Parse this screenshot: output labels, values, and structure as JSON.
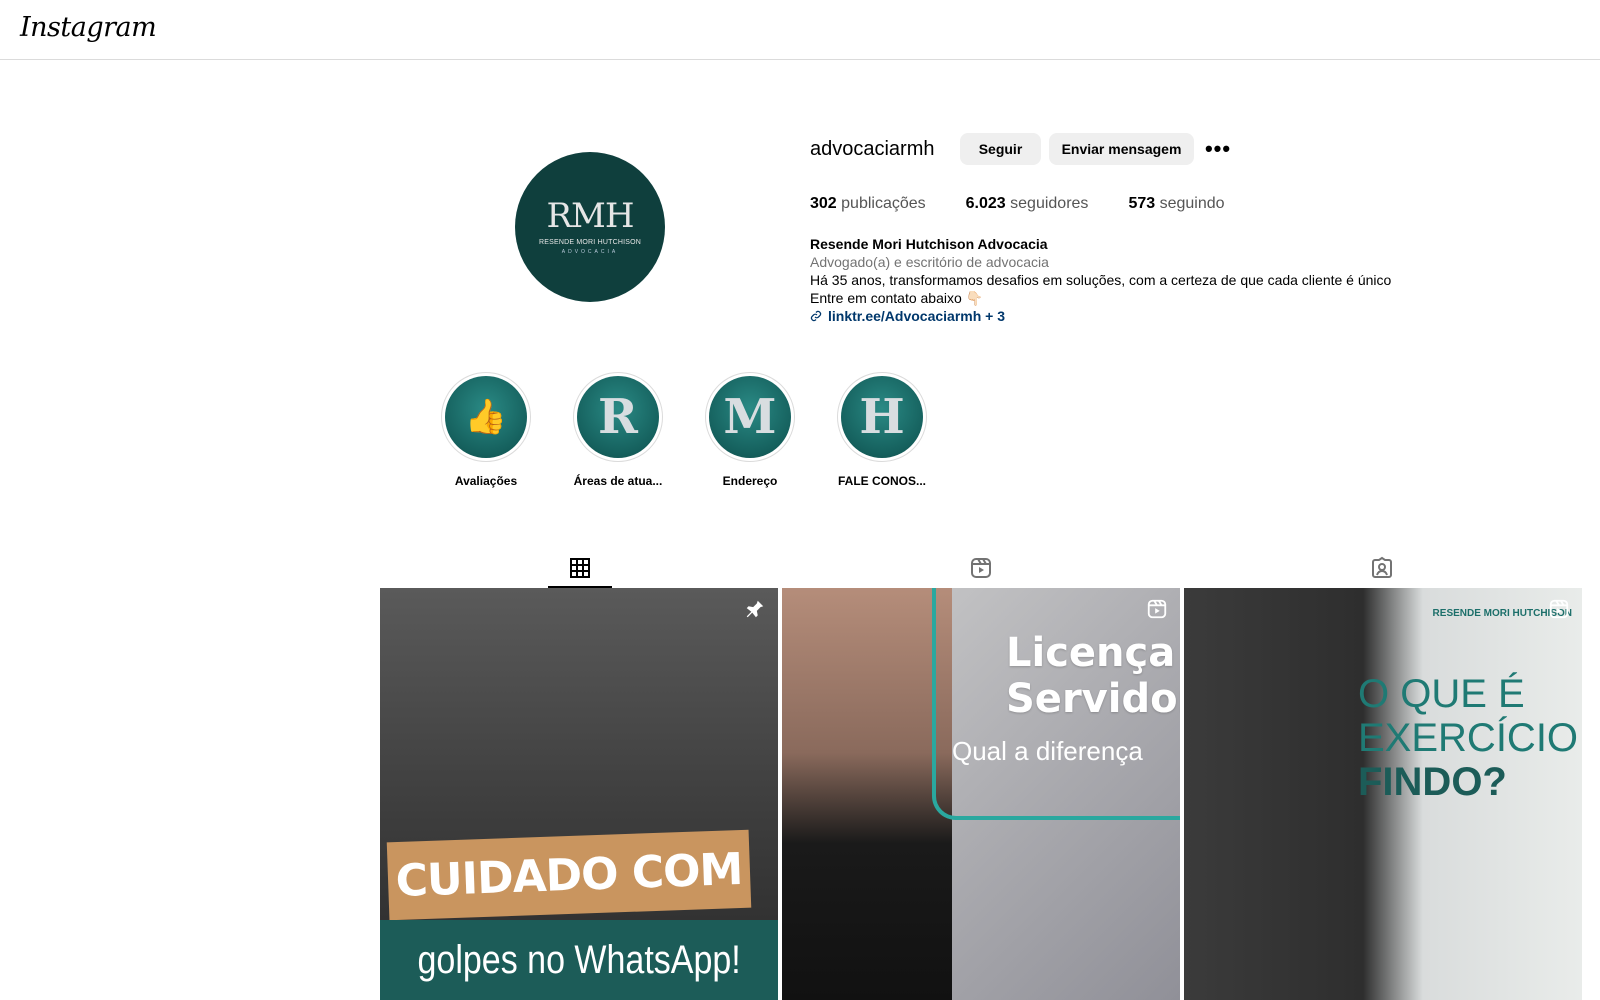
{
  "app": {
    "logo": "Instagram"
  },
  "profile": {
    "avatar": {
      "monogram": "RMH",
      "line1": "RESENDE MORI HUTCHISON",
      "line2": "ADVOCACIA"
    },
    "username": "advocaciarmh",
    "actions": {
      "follow": "Seguir",
      "message": "Enviar mensagem",
      "more": "•••"
    },
    "stats": [
      {
        "value": "302",
        "label": "publicações"
      },
      {
        "value": "6.023",
        "label": "seguidores"
      },
      {
        "value": "573",
        "label": "seguindo"
      }
    ],
    "bio": {
      "name": "Resende Mori Hutchison Advocacia",
      "category": "Advogado(a) e escritório de advocacia",
      "line1": "Há 35 anos, transformamos desafios em soluções, com a certeza de que cada cliente é único",
      "line2": "Entre em contato abaixo 👇🏻",
      "link": "linktr.ee/Advocaciarmh + 3"
    }
  },
  "highlights": [
    {
      "label": "Avaliações",
      "glyph": "👍"
    },
    {
      "label": "Áreas de atua...",
      "glyph": "R"
    },
    {
      "label": "Endereço",
      "glyph": "M"
    },
    {
      "label": "FALE CONOS...",
      "glyph": "H"
    }
  ],
  "tabs": [
    {
      "name": "posts",
      "icon": "grid-icon",
      "active": true
    },
    {
      "name": "reels",
      "icon": "reels-icon",
      "active": false
    },
    {
      "name": "tagged",
      "icon": "tagged-icon",
      "active": false
    }
  ],
  "posts": [
    {
      "overlay_icon": "pin-icon",
      "banner_top": "CUIDADO COM",
      "banner_bottom": "golpes no WhatsApp!"
    },
    {
      "overlay_icon": "reels-icon",
      "title_line1": "Licença",
      "title_line2": "Servidor",
      "subtitle": "Qual a diferença"
    },
    {
      "overlay_icon": "reels-icon",
      "logo_text": "RESENDE MORI HUTCHISON",
      "line1": "O QUE É",
      "line2": "EXERCÍCIO",
      "line3": "FINDO?"
    }
  ],
  "colors": {
    "brand_teal": "#0f3f3d",
    "link": "#00376b",
    "button_bg": "#efefef"
  }
}
